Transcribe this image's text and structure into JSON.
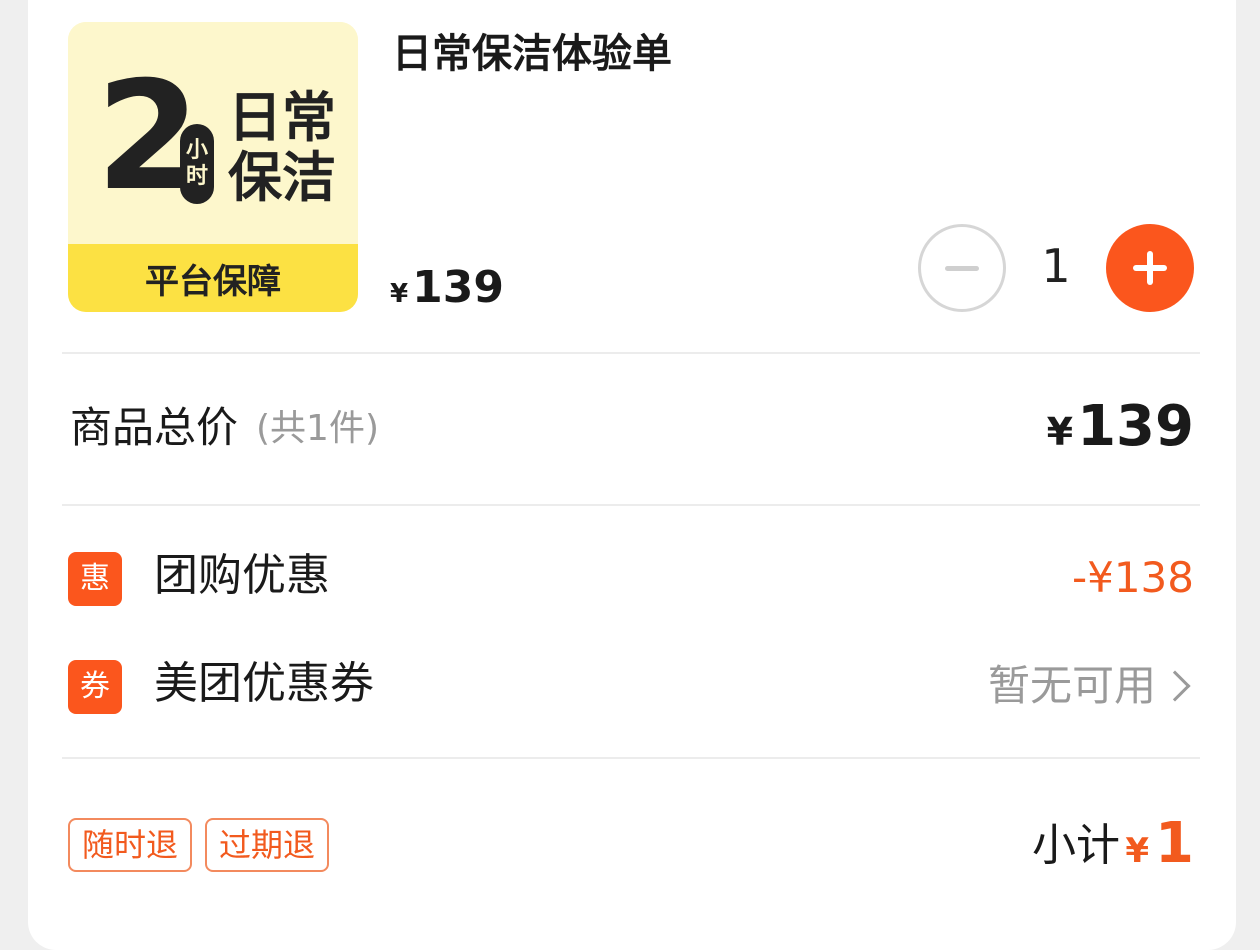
{
  "product": {
    "thumbnail": {
      "number": "2",
      "unit_top": "小",
      "unit_bottom": "时",
      "title_line1": "日常",
      "title_line2": "保洁",
      "badge": "平台保障"
    },
    "name": "日常保洁体验单",
    "price_symbol": "¥",
    "price": "139",
    "quantity": "1"
  },
  "summary": {
    "total_label": "商品总价",
    "total_count": "(共1件)",
    "total_symbol": "¥",
    "total_value": "139"
  },
  "discounts": [
    {
      "icon_text": "惠",
      "label": "团购优惠",
      "value": "-¥138"
    },
    {
      "icon_text": "券",
      "label": "美团优惠券",
      "value": "暂无可用"
    }
  ],
  "policies": [
    "随时退",
    "过期退"
  ],
  "subtotal": {
    "label": "小计",
    "symbol": "¥",
    "value": "1"
  },
  "colors": {
    "accent": "#fb561d",
    "badge_yellow": "#fce143",
    "thumb_bg": "#fdf7cc"
  }
}
